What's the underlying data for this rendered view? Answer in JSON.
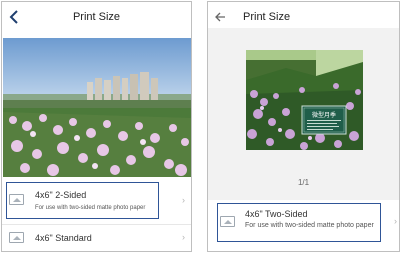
{
  "left_screen": {
    "title": "Print Size",
    "back_icon": "chevron-left-icon",
    "options": [
      {
        "label": "4x6\" 2-Sided",
        "description": "For use with two-sided matte photo paper",
        "icon": "photo-paper-icon",
        "selected": true
      },
      {
        "label": "4x6\" Standard",
        "icon": "photo-paper-icon",
        "selected": false
      }
    ]
  },
  "right_screen": {
    "title": "Print Size",
    "back_icon": "arrow-left-icon",
    "page_count": "1/1",
    "sign_text": "微型月季",
    "option": {
      "label": "4x6\" Two-Sided",
      "description": "For use with two-sided matte photo paper",
      "icon": "photo-paper-icon",
      "selected": true
    }
  },
  "colors": {
    "selection_border": "#2f5597",
    "back_icon_left": "#1f3f6f"
  }
}
